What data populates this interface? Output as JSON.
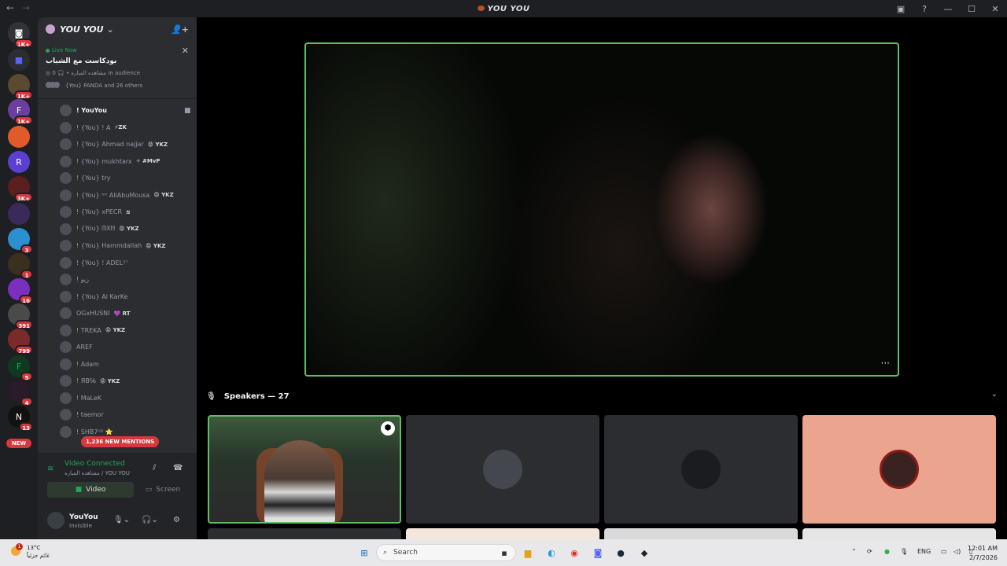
{
  "window": {
    "title": "YOU YOU"
  },
  "guilds": {
    "badges": [
      "1K+",
      "1K+",
      "1K+",
      "3K+",
      "3",
      "1",
      "16",
      "391",
      "799",
      "5",
      "4",
      "13"
    ],
    "new_label": "NEW"
  },
  "server": {
    "name": "YOU YOU"
  },
  "live_event": {
    "tag": "Live Now",
    "title": "بودكاست مع الشباب",
    "channel": "مشاهده المباره",
    "audience": "0 in audience",
    "participants": "{You} PANDA and 26 others"
  },
  "members": [
    {
      "name": "! YouYou",
      "role": ""
    },
    {
      "name": "! {You} ! A",
      "role": "⚡ZK"
    },
    {
      "name": "! {You} Ahmad najjar",
      "role": "😡 YKZ"
    },
    {
      "name": "! {You} mukhtarx",
      "role": "✧ #MvP"
    },
    {
      "name": "! {You} try",
      "role": ""
    },
    {
      "name": "! {You} ᵐʳ AliAbuMousa",
      "role": "😡 YKZ"
    },
    {
      "name": "! {You} xPECR",
      "role": "≋"
    },
    {
      "name": "! {You} ᗰXᗷ",
      "role": "😡 YKZ"
    },
    {
      "name": "! {You} Hammdallah",
      "role": "😡 YKZ"
    },
    {
      "name": "! {You} ! ADEL³⁷",
      "role": ""
    },
    {
      "name": "! زيو",
      "role": ""
    },
    {
      "name": "! {You} Al KarKe",
      "role": ""
    },
    {
      "name": "OGxHUSNI",
      "role": "💜 RT"
    },
    {
      "name": "! TREKA",
      "role": "😡 YKZ"
    },
    {
      "name": "AREF",
      "role": ""
    },
    {
      "name": "! Adam",
      "role": ""
    },
    {
      "name": "! ЯB℅",
      "role": "😡 YKZ"
    },
    {
      "name": "! MaLeK",
      "role": ""
    },
    {
      "name": "! taemor",
      "role": ""
    },
    {
      "name": "! SHB7ᴬᴮ ⭐",
      "role": ""
    }
  ],
  "mentions": "1,236 NEW MENTIONS",
  "voice": {
    "status": "Video Connected",
    "channel": "مشاهده المباره / YOU YOU",
    "video_label": "Video",
    "screen_label": "Screen"
  },
  "user": {
    "name": "YouYou",
    "status": "Invisible"
  },
  "stage": {
    "speakers_label": "Speakers — 27",
    "more_label": "···"
  },
  "taskbar": {
    "temperature": "13°C",
    "weather": "غائم جزئياً",
    "weather_badge": "1",
    "search_placeholder": "Search",
    "language": "ENG",
    "time": "12:01 AM",
    "date": "2/7/2026"
  },
  "colors": {
    "accent_green": "#23a55a",
    "speaking_border": "#5fbf68",
    "mention_red": "#da373c",
    "peach_tile": "#eba58f"
  }
}
